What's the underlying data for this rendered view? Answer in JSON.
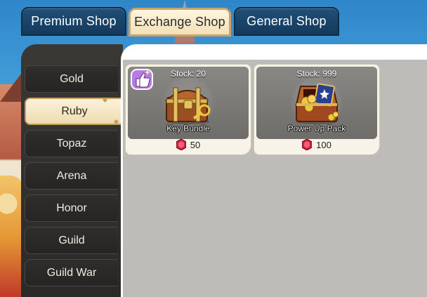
{
  "top_tabs": [
    {
      "label": "Premium Shop",
      "active": false
    },
    {
      "label": "Exchange Shop",
      "active": true
    },
    {
      "label": "General Shop",
      "active": false
    }
  ],
  "categories": [
    {
      "label": "Gold",
      "active": false
    },
    {
      "label": "Ruby",
      "active": true
    },
    {
      "label": "Topaz",
      "active": false
    },
    {
      "label": "Arena",
      "active": false
    },
    {
      "label": "Honor",
      "active": false
    },
    {
      "label": "Guild",
      "active": false
    },
    {
      "label": "Guild War",
      "active": false
    }
  ],
  "items": [
    {
      "stock": "Stock: 20",
      "name": "Key Bundle",
      "price": "50",
      "currency_icon": "ruby-icon",
      "badge": "thumbs-up-icon"
    },
    {
      "stock": "Stock: 999",
      "name": "Power Up Pack",
      "price": "100",
      "currency_icon": "ruby-icon"
    }
  ],
  "colors": {
    "tab_bg": "#1f4f78",
    "tab_active_bg": "#f2e0b6",
    "sidebar_bg": "#2b2a28",
    "panel_bg": "#bdbcb9",
    "ruby": "#d11f3a"
  }
}
